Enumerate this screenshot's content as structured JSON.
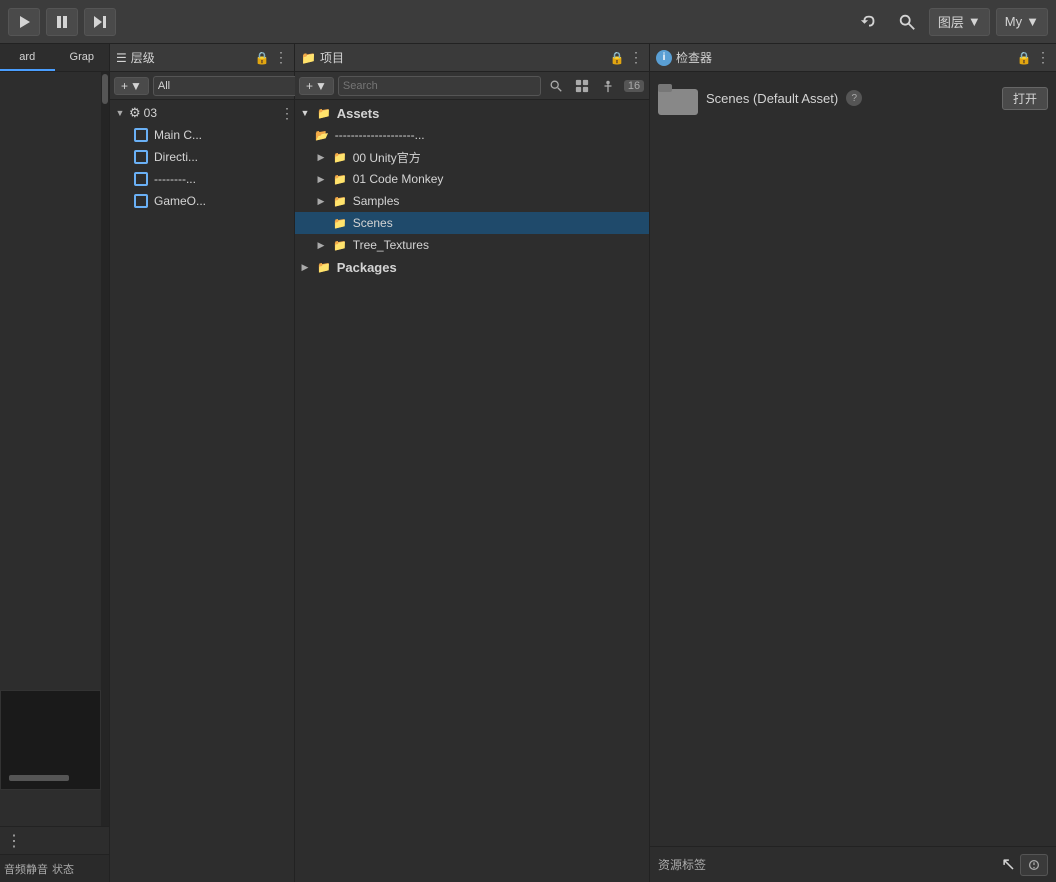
{
  "toolbar": {
    "play_label": "▶",
    "pause_label": "⏸",
    "step_label": "⏭",
    "undo_label": "↺",
    "layers_label": "图层",
    "layers_dropdown_icon": "▼",
    "account_label": "My",
    "account_dropdown_icon": "▼"
  },
  "hierarchy": {
    "panel_title": "层级",
    "add_label": "+",
    "add_dropdown": "▼",
    "search_placeholder": "All",
    "items": [
      {
        "id": "item-03",
        "label": "03",
        "indent": 0,
        "type": "settings",
        "expanded": true,
        "arrow": "▼"
      },
      {
        "id": "item-maincam",
        "label": "Main C...",
        "indent": 1,
        "type": "cube"
      },
      {
        "id": "item-directional",
        "label": "Directi...",
        "indent": 1,
        "type": "cube"
      },
      {
        "id": "item-separator",
        "label": "--------...",
        "indent": 1,
        "type": "cube"
      },
      {
        "id": "item-gameobj",
        "label": "GameO...",
        "indent": 1,
        "type": "cube"
      }
    ]
  },
  "project": {
    "panel_title": "项目",
    "add_label": "+",
    "add_dropdown": "▼",
    "badge_label": "16",
    "tree": [
      {
        "id": "assets",
        "label": "Assets",
        "indent": 0,
        "type": "folder",
        "expanded": true,
        "arrow": "▼"
      },
      {
        "id": "sep1",
        "label": "--------------------...",
        "indent": 1,
        "type": "folder_outline"
      },
      {
        "id": "unity",
        "label": "00 Unity官方",
        "indent": 1,
        "type": "folder",
        "arrow": "▶"
      },
      {
        "id": "codemonkey",
        "label": "01 Code Monkey",
        "indent": 1,
        "type": "folder",
        "arrow": "▶"
      },
      {
        "id": "samples",
        "label": "Samples",
        "indent": 1,
        "type": "folder",
        "arrow": "▶"
      },
      {
        "id": "scenes",
        "label": "Scenes",
        "indent": 1,
        "type": "folder",
        "selected": true
      },
      {
        "id": "treetextures",
        "label": "Tree_Textures",
        "indent": 1,
        "type": "folder",
        "arrow": "▶"
      },
      {
        "id": "packages",
        "label": "Packages",
        "indent": 0,
        "type": "folder",
        "arrow": "▶"
      }
    ]
  },
  "inspector": {
    "panel_title": "检查器",
    "asset_title": "Scenes (Default Asset)",
    "open_btn_label": "打开",
    "help_icon": "?",
    "tags_label": "资源标签",
    "cursor_indicator": "🖱"
  },
  "statusbar": {
    "mute_label": "音频静音",
    "status_label": "状态"
  }
}
